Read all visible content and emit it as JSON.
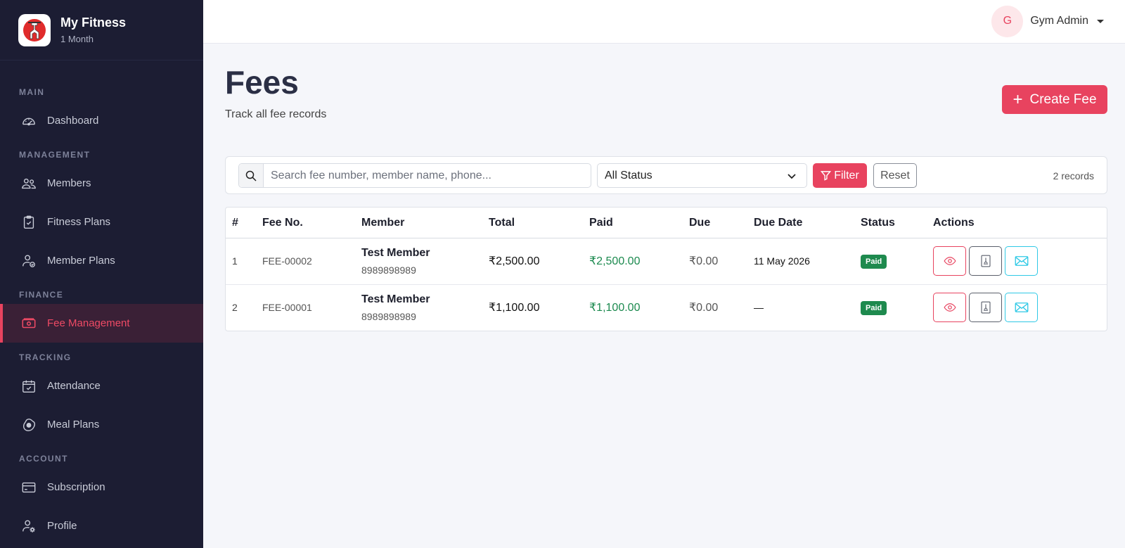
{
  "brand": {
    "title": "My Fitness",
    "subtitle": "1 Month"
  },
  "sidebar": {
    "sections": [
      {
        "label": "MAIN",
        "items": [
          {
            "label": "Dashboard",
            "icon": "speedometer-icon"
          }
        ]
      },
      {
        "label": "MANAGEMENT",
        "items": [
          {
            "label": "Members",
            "icon": "people-icon"
          },
          {
            "label": "Fitness Plans",
            "icon": "clipboard-check-icon"
          },
          {
            "label": "Member Plans",
            "icon": "person-check-icon"
          }
        ]
      },
      {
        "label": "FINANCE",
        "items": [
          {
            "label": "Fee Management",
            "icon": "cash-icon",
            "active": true
          }
        ]
      },
      {
        "label": "TRACKING",
        "items": [
          {
            "label": "Attendance",
            "icon": "calendar-check-icon"
          },
          {
            "label": "Meal Plans",
            "icon": "egg-fried-icon"
          }
        ]
      },
      {
        "label": "ACCOUNT",
        "items": [
          {
            "label": "Subscription",
            "icon": "credit-card-icon"
          },
          {
            "label": "Profile",
            "icon": "person-gear-icon"
          }
        ]
      }
    ]
  },
  "topbar": {
    "avatar_initial": "G",
    "user_name": "Gym Admin"
  },
  "page": {
    "title": "Fees",
    "subtitle": "Track all fee records",
    "create_label": "Create Fee"
  },
  "filters": {
    "search_placeholder": "Search fee number, member name, phone...",
    "status_value": "All Status",
    "filter_label": "Filter",
    "reset_label": "Reset",
    "records": "2 records"
  },
  "table": {
    "headers": [
      "#",
      "Fee No.",
      "Member",
      "Total",
      "Paid",
      "Due",
      "Due Date",
      "Status",
      "Actions"
    ],
    "rows": [
      {
        "index": "1",
        "fee_no": "FEE-00002",
        "member": "Test Member",
        "phone": "8989898989",
        "total": "₹2,500.00",
        "paid": "₹2,500.00",
        "due": "₹0.00",
        "due_date": "11 May 2026",
        "status": "Paid"
      },
      {
        "index": "2",
        "fee_no": "FEE-00001",
        "member": "Test Member",
        "phone": "8989898989",
        "total": "₹1,100.00",
        "paid": "₹1,100.00",
        "due": "₹0.00",
        "due_date": "—",
        "status": "Paid"
      }
    ]
  },
  "colors": {
    "accent": "#e8435f",
    "sidebar_bg": "#1c1d33",
    "paid_green": "#1c8a4f",
    "mail_cyan": "#2fc9e6"
  }
}
